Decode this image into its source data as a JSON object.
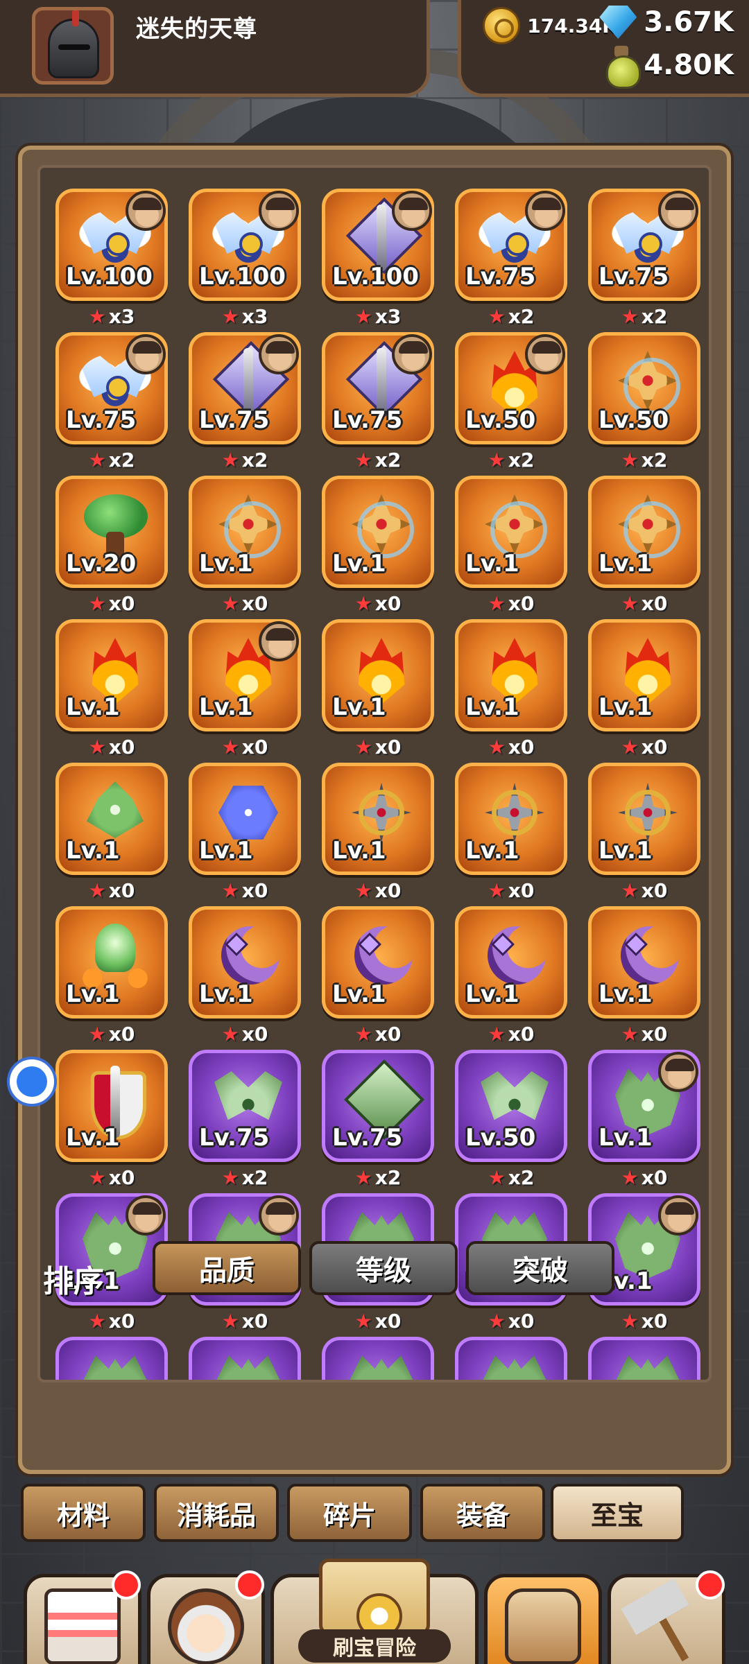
{
  "player": {
    "name": "迷失的天尊"
  },
  "resources": {
    "gold": "174.34K",
    "gems": "3.67K",
    "potion": "4.80K"
  },
  "items": [
    {
      "icon": "wing-blue",
      "level": "Lv.100",
      "stars": "x3",
      "rarity": "orange",
      "owner": true
    },
    {
      "icon": "wing-blue",
      "level": "Lv.100",
      "stars": "x3",
      "rarity": "orange",
      "owner": true
    },
    {
      "icon": "spear",
      "level": "Lv.100",
      "stars": "x3",
      "rarity": "orange",
      "owner": true
    },
    {
      "icon": "wing-blue",
      "level": "Lv.75",
      "stars": "x2",
      "rarity": "orange",
      "owner": true
    },
    {
      "icon": "wing-blue",
      "level": "Lv.75",
      "stars": "x2",
      "rarity": "orange",
      "owner": true
    },
    {
      "icon": "wing-blue",
      "level": "Lv.75",
      "stars": "x2",
      "rarity": "orange",
      "owner": true
    },
    {
      "icon": "spear",
      "level": "Lv.75",
      "stars": "x2",
      "rarity": "orange",
      "owner": true
    },
    {
      "icon": "spear",
      "level": "Lv.75",
      "stars": "x2",
      "rarity": "orange",
      "owner": true
    },
    {
      "icon": "flame-crown",
      "level": "Lv.50",
      "stars": "x2",
      "rarity": "orange",
      "owner": true
    },
    {
      "icon": "cross-shield",
      "level": "Lv.50",
      "stars": "x2",
      "rarity": "orange",
      "owner": false
    },
    {
      "icon": "tree",
      "level": "Lv.20",
      "stars": "x0",
      "rarity": "orange",
      "owner": false
    },
    {
      "icon": "cross-shield",
      "level": "Lv.1",
      "stars": "x0",
      "rarity": "orange",
      "owner": false
    },
    {
      "icon": "cross-shield",
      "level": "Lv.1",
      "stars": "x0",
      "rarity": "orange",
      "owner": false
    },
    {
      "icon": "cross-shield",
      "level": "Lv.1",
      "stars": "x0",
      "rarity": "orange",
      "owner": false
    },
    {
      "icon": "cross-shield",
      "level": "Lv.1",
      "stars": "x0",
      "rarity": "orange",
      "owner": false
    },
    {
      "icon": "flame",
      "level": "Lv.1",
      "stars": "x0",
      "rarity": "orange",
      "owner": false
    },
    {
      "icon": "flame",
      "level": "Lv.1",
      "stars": "x0",
      "rarity": "orange",
      "owner": true
    },
    {
      "icon": "flame",
      "level": "Lv.1",
      "stars": "x0",
      "rarity": "orange",
      "owner": false
    },
    {
      "icon": "flame",
      "level": "Lv.1",
      "stars": "x0",
      "rarity": "orange",
      "owner": false
    },
    {
      "icon": "flame",
      "level": "Lv.1",
      "stars": "x0",
      "rarity": "orange",
      "owner": false
    },
    {
      "icon": "leaf-gem",
      "level": "Lv.1",
      "stars": "x0",
      "rarity": "orange",
      "owner": false
    },
    {
      "icon": "snowflake",
      "level": "Lv.1",
      "stars": "x0",
      "rarity": "orange",
      "owner": false
    },
    {
      "icon": "shuriken",
      "level": "Lv.1",
      "stars": "x0",
      "rarity": "orange",
      "owner": false
    },
    {
      "icon": "shuriken",
      "level": "Lv.1",
      "stars": "x0",
      "rarity": "orange",
      "owner": false
    },
    {
      "icon": "shuriken",
      "level": "Lv.1",
      "stars": "x0",
      "rarity": "orange",
      "owner": false
    },
    {
      "icon": "orange-plant",
      "level": "Lv.1",
      "stars": "x0",
      "rarity": "orange",
      "owner": false
    },
    {
      "icon": "moon",
      "level": "Lv.1",
      "stars": "x0",
      "rarity": "orange",
      "owner": false
    },
    {
      "icon": "moon",
      "level": "Lv.1",
      "stars": "x0",
      "rarity": "orange",
      "owner": false
    },
    {
      "icon": "moon",
      "level": "Lv.1",
      "stars": "x0",
      "rarity": "orange",
      "owner": false
    },
    {
      "icon": "moon",
      "level": "Lv.1",
      "stars": "x0",
      "rarity": "orange",
      "owner": false
    },
    {
      "icon": "sword-shield",
      "level": "Lv.1",
      "stars": "x0",
      "rarity": "orange",
      "owner": false
    },
    {
      "icon": "green-wing",
      "level": "Lv.75",
      "stars": "x2",
      "rarity": "purple",
      "owner": false
    },
    {
      "icon": "green-gem",
      "level": "Lv.75",
      "stars": "x2",
      "rarity": "purple",
      "owner": false
    },
    {
      "icon": "green-wing",
      "level": "Lv.50",
      "stars": "x2",
      "rarity": "purple",
      "owner": false
    },
    {
      "icon": "dragon",
      "level": "Lv.1",
      "stars": "x0",
      "rarity": "purple",
      "owner": true
    },
    {
      "icon": "dragon",
      "level": "Lv.1",
      "stars": "x0",
      "rarity": "purple",
      "owner": true
    },
    {
      "icon": "dragon",
      "level": "Lv.1",
      "stars": "x0",
      "rarity": "purple",
      "owner": true
    },
    {
      "icon": "dragon",
      "level": "Lv.1",
      "stars": "x0",
      "rarity": "purple",
      "owner": false
    },
    {
      "icon": "dragon",
      "level": "Lv.1",
      "stars": "x0",
      "rarity": "purple",
      "owner": false
    },
    {
      "icon": "dragon",
      "level": "Lv.1",
      "stars": "x0",
      "rarity": "purple",
      "owner": true
    },
    {
      "icon": "dragon",
      "level": "",
      "stars": "",
      "rarity": "purple",
      "owner": false
    },
    {
      "icon": "dragon",
      "level": "",
      "stars": "",
      "rarity": "purple",
      "owner": false
    },
    {
      "icon": "dragon",
      "level": "",
      "stars": "",
      "rarity": "purple",
      "owner": false
    },
    {
      "icon": "dragon",
      "level": "",
      "stars": "",
      "rarity": "purple",
      "owner": false
    },
    {
      "icon": "dragon",
      "level": "",
      "stars": "",
      "rarity": "purple",
      "owner": false
    }
  ],
  "sort": {
    "label": "排序",
    "options": [
      "品质",
      "等级",
      "突破"
    ],
    "active": "品质"
  },
  "categories": {
    "items": [
      "材料",
      "消耗品",
      "碎片",
      "装备",
      "至宝"
    ],
    "active": "至宝"
  },
  "nav": {
    "map_label": "刷宝冒险"
  },
  "colors": {
    "orange_tile": "#e07822",
    "purple_tile": "#7d3fbf",
    "star": "#ff3b3b"
  }
}
